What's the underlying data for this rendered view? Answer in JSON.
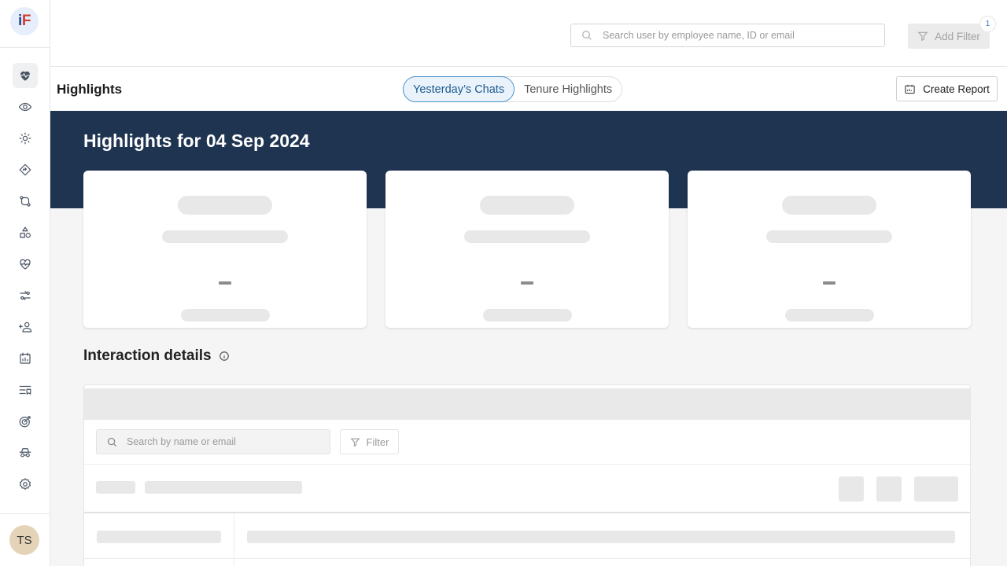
{
  "app": {
    "logo_i": "i",
    "logo_f": "F",
    "avatar_initials": "TS"
  },
  "sidebar": {
    "items": [
      {
        "icon": "heart-icon",
        "active": true
      },
      {
        "icon": "eye-icon"
      },
      {
        "icon": "sun-icon"
      },
      {
        "icon": "diamond-icon"
      },
      {
        "icon": "route-icon"
      },
      {
        "icon": "shapes-icon"
      },
      {
        "icon": "heartbeat-icon"
      },
      {
        "icon": "exchange-icon"
      },
      {
        "icon": "add-user-icon"
      },
      {
        "icon": "report-icon"
      },
      {
        "icon": "queue-icon"
      },
      {
        "icon": "target-icon"
      },
      {
        "icon": "incognito-icon"
      },
      {
        "icon": "gear-icon"
      }
    ]
  },
  "topbar": {
    "search_placeholder": "Search user by employee name, ID or email",
    "add_filter_label": "Add Filter",
    "filter_badge_count": "1"
  },
  "subheader": {
    "title": "Highlights",
    "tabs": [
      {
        "label": "Yesterday’s Chats",
        "active": true
      },
      {
        "label": "Tenure Highlights",
        "active": false
      }
    ],
    "create_report_label": "Create Report"
  },
  "banner": {
    "title": "Highlights for 04 Sep 2024"
  },
  "cards": [
    {
      "value": "–"
    },
    {
      "value": "–"
    },
    {
      "value": "–"
    }
  ],
  "interaction": {
    "title": "Interaction details",
    "search_placeholder": "Search by name or email",
    "filter_label": "Filter"
  },
  "colors": {
    "banner_bg": "#1f3451",
    "accent": "#4e94c9",
    "skeleton": "#e8e8e8"
  }
}
